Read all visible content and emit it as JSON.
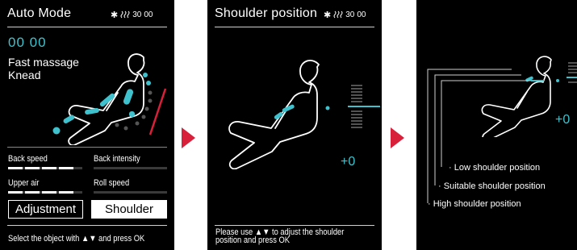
{
  "colors": {
    "accent": "#3fc2cd",
    "arrow": "#d8203a",
    "panel_bg": "#000000",
    "warning_bar": "#d8203a"
  },
  "screen1": {
    "title": "Auto Mode",
    "status": {
      "bluetooth_icon": "bluetooth-icon",
      "heat_icon": "heat-icon",
      "minutes": "30",
      "seconds": "00"
    },
    "timer": "00 00",
    "mode_line1": "Fast massage",
    "mode_line2": "Knead",
    "controls": {
      "back_speed": "Back speed",
      "back_intensity": "Back intensity",
      "upper_air": "Upper air",
      "roll_speed": "Roll speed"
    },
    "adjustment_button": "Adjustment",
    "shoulder_button": "Shoulder",
    "footer": "Select the object with ▲▼ and press OK"
  },
  "screen2": {
    "title": "Shoulder position",
    "status": {
      "bluetooth_icon": "bluetooth-icon",
      "heat_icon": "heat-icon",
      "minutes": "30",
      "seconds": "00"
    },
    "value": "+0",
    "footer_line1": "Please use ▲▼ to adjust the shoulder",
    "footer_line2": "position and press OK"
  },
  "screen3": {
    "value": "+0",
    "labels": {
      "low": "Low shoulder position",
      "suitable": "Suitable shoulder position",
      "high": "High shoulder position"
    }
  }
}
